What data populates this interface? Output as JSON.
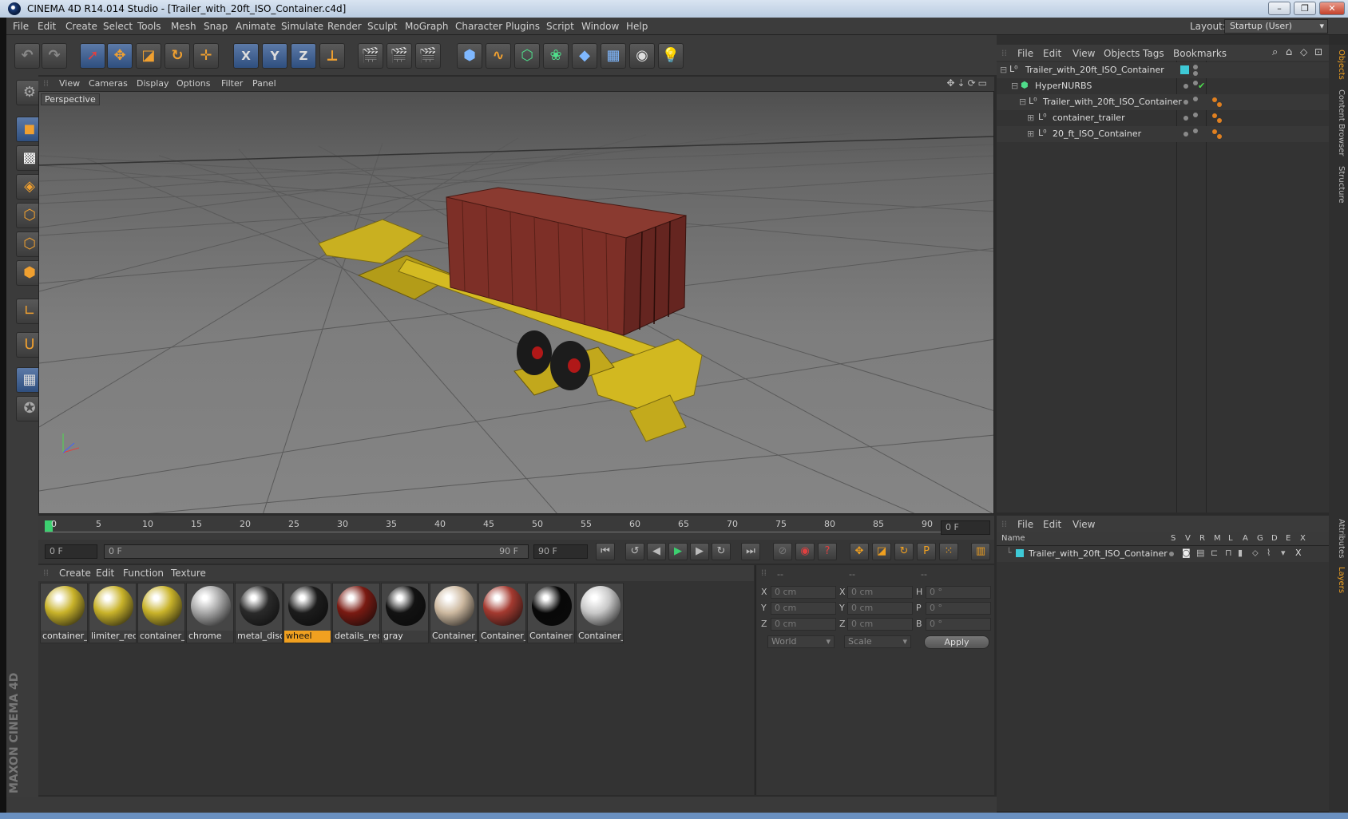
{
  "window": {
    "title": "CINEMA 4D R14.014 Studio - [Trailer_with_20ft_ISO_Container.c4d]",
    "buttons": [
      "–",
      "❐",
      "✕"
    ]
  },
  "menubar": {
    "items": [
      "File",
      "Edit",
      "Create",
      "Select",
      "Tools",
      "Mesh",
      "Snap",
      "Animate",
      "Simulate",
      "Render",
      "Sculpt",
      "MoGraph",
      "Character",
      "Plugins",
      "Script",
      "Window",
      "Help"
    ],
    "layout_label": "Layout:",
    "layout_value": "Startup (User)"
  },
  "toolbar": {
    "axis_x": "X",
    "axis_y": "Y",
    "axis_z": "Z"
  },
  "viewport": {
    "menu": [
      "View",
      "Cameras",
      "Display",
      "Options",
      "Filter",
      "Panel"
    ],
    "label": "Perspective"
  },
  "timeline": {
    "ticks": [
      "0",
      "5",
      "10",
      "15",
      "20",
      "25",
      "30",
      "35",
      "40",
      "45",
      "50",
      "55",
      "60",
      "65",
      "70",
      "75",
      "80",
      "85",
      "90"
    ],
    "current_frame": "0 F",
    "start_field": "0 F",
    "slider_start": "0 F",
    "slider_end": "90 F",
    "end_field": "90 F"
  },
  "material_manager": {
    "menu": [
      "Create",
      "Edit",
      "Function",
      "Texture"
    ],
    "materials": [
      {
        "name": "container_l",
        "color": "#c9b32a",
        "selected": false
      },
      {
        "name": "limiter_red",
        "color": "#c9b32a",
        "selected": false
      },
      {
        "name": "container_t",
        "color": "#c9b32a",
        "selected": false
      },
      {
        "name": "chrome",
        "color": "#a8a8a8",
        "selected": false
      },
      {
        "name": "metal_disc",
        "color": "#2a2a2a",
        "selected": false
      },
      {
        "name": "wheel",
        "color": "#1c1c1c",
        "selected": true
      },
      {
        "name": "details_red",
        "color": "#7a1a12",
        "selected": false
      },
      {
        "name": "gray",
        "color": "#121212",
        "selected": false
      },
      {
        "name": "Container_",
        "color": "#cdb9a0",
        "selected": false
      },
      {
        "name": "Container_",
        "color": "#a43a30",
        "selected": false
      },
      {
        "name": "Container",
        "color": "#080808",
        "selected": false
      },
      {
        "name": "Container_",
        "color": "#c8c8c8",
        "selected": false
      }
    ]
  },
  "coordinates": {
    "headers": [
      "--",
      "--",
      "--"
    ],
    "rows": [
      {
        "l1": "X",
        "v1": "0 cm",
        "l2": "X",
        "v2": "0 cm",
        "l3": "H",
        "v3": "0 °"
      },
      {
        "l1": "Y",
        "v1": "0 cm",
        "l2": "Y",
        "v2": "0 cm",
        "l3": "P",
        "v3": "0 °"
      },
      {
        "l1": "Z",
        "v1": "0 cm",
        "l2": "Z",
        "v2": "0 cm",
        "l3": "B",
        "v3": "0 °"
      }
    ],
    "mode1": "World",
    "mode2": "Scale",
    "apply": "Apply"
  },
  "object_manager": {
    "menu": [
      "File",
      "Edit",
      "View",
      "Objects",
      "Tags",
      "Bookmarks"
    ],
    "objects": [
      {
        "name": "Trailer_with_20ft_ISO_Container",
        "indent": 0
      },
      {
        "name": "HyperNURBS",
        "indent": 1
      },
      {
        "name": "Trailer_with_20ft_ISO_Container",
        "indent": 2
      },
      {
        "name": "container_trailer",
        "indent": 3
      },
      {
        "name": "20_ft_ISO_Container",
        "indent": 3
      }
    ]
  },
  "layer_manager": {
    "menu": [
      "File",
      "Edit",
      "View"
    ],
    "columns": [
      "Name",
      "S",
      "V",
      "R",
      "M",
      "L",
      "A",
      "G",
      "D",
      "E",
      "X"
    ],
    "row": "Trailer_with_20ft_ISO_Container"
  },
  "side_tabs": [
    "Objects",
    "Content Browser",
    "Structure",
    "Attributes",
    "Layers"
  ],
  "branding": "MAXON CINEMA 4D",
  "colors": {
    "accent": "#f0a020",
    "selection": "#3f6aa8",
    "layer_color": "#3ec9d6"
  }
}
